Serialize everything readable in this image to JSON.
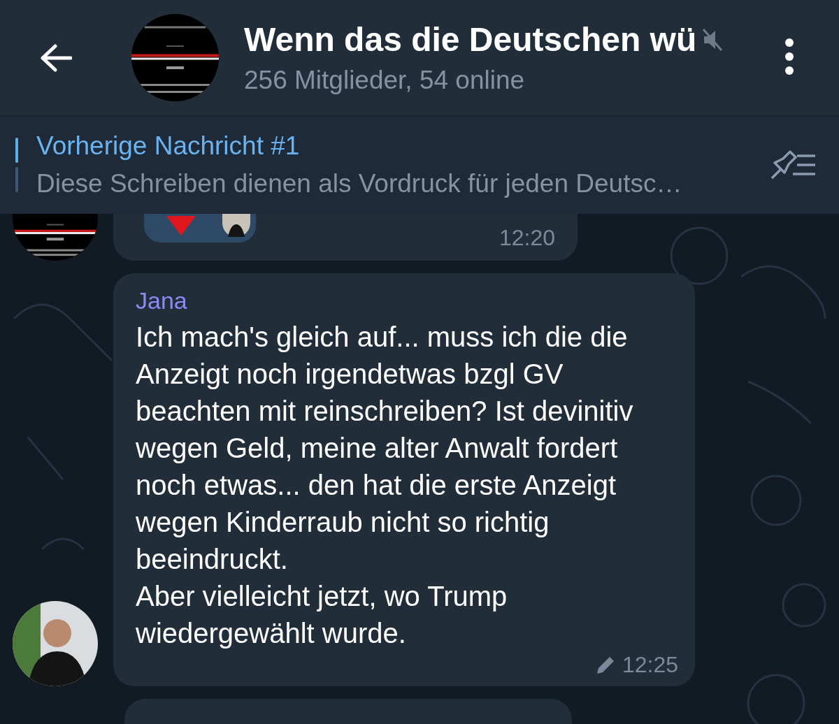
{
  "header": {
    "title": "Wenn das die Deutschen wü",
    "muted": true,
    "subtitle": "256 Mitglieder, 54 online"
  },
  "pinned": {
    "label": "Vorherige Nachricht #1",
    "text": "Diese Schreiben dienen als Vordruck für jeden Deutsc…"
  },
  "messages": [
    {
      "kind": "reactions",
      "time": "12:20"
    },
    {
      "kind": "text",
      "sender": "Jana",
      "text": "Ich mach's gleich auf... muss ich die die Anzeigt noch irgendetwas bzgl GV beachten mit reinschreiben? Ist devinitiv wegen Geld, meine alter Anwalt fordert noch etwas... den hat die erste Anzeigt wegen Kinderraub nicht so richtig beeindruckt.\nAber vielleicht jetzt, wo Trump wiedergewählt wurde.",
      "edited": true,
      "time": "12:25"
    },
    {
      "kind": "cut-off"
    }
  ]
}
